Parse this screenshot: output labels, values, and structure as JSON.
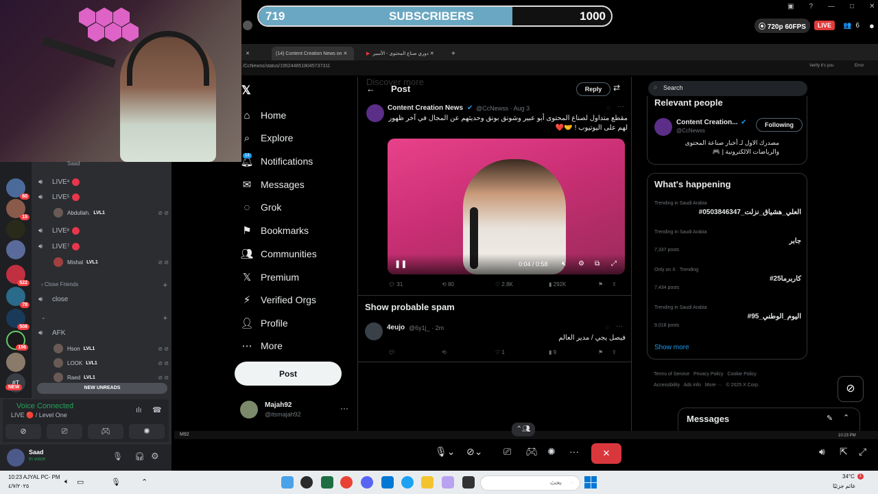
{
  "stream": {
    "subscribers_current": "719",
    "subscribers_label": "SUBSCRIBERS",
    "subscribers_goal": "1000",
    "subscribers_progress": 0.719,
    "quality": "720p 60FPS",
    "live": "LIVE",
    "viewers": "6"
  },
  "browser": {
    "tabs": [
      "(14) Content Creation News on",
      "دوري صناع المحتوى - الأسير"
    ],
    "url": "/CcNewss/status/1952448518045737311",
    "verify_label": "Verify it's you",
    "error_label": "Error"
  },
  "x_nav": {
    "items": [
      {
        "label": "Home",
        "icon": "home-icon"
      },
      {
        "label": "Explore",
        "icon": "search-icon"
      },
      {
        "label": "Notifications",
        "icon": "bell-icon",
        "badge": "14"
      },
      {
        "label": "Messages",
        "icon": "mail-icon"
      },
      {
        "label": "Grok",
        "icon": "grok-icon"
      },
      {
        "label": "Bookmarks",
        "icon": "bookmark-icon"
      },
      {
        "label": "Communities",
        "icon": "people-icon"
      },
      {
        "label": "Premium",
        "icon": "x-logo-icon"
      },
      {
        "label": "Verified Orgs",
        "icon": "lightning-icon"
      },
      {
        "label": "Profile",
        "icon": "person-icon"
      },
      {
        "label": "More",
        "icon": "more-circle-icon"
      }
    ],
    "post_label": "Post",
    "profile_name": "Majah92",
    "profile_handle": "@itsmajah92"
  },
  "post_header": {
    "title": "Post",
    "reply_label": "Reply",
    "ghost_text": "Discover more"
  },
  "tweet": {
    "author": "Content Creation News",
    "handle": "@CcNewss · Aug 3",
    "text": "مقطع متداول لصناع المحتوى أبو عبير وشونق بونق وحديثهم عن المجال في آخر ظهور لهم على اليوتيوب ! 🤝❤️",
    "video_time": "0:04 / 0:58",
    "stats": {
      "replies": "31",
      "reposts": "80",
      "likes": "2.8K",
      "views": "292K"
    }
  },
  "spam_section": {
    "heading": "Show probable spam",
    "author": "4eujo",
    "handle": "@6y1j_ · 2m",
    "text": "فيصل يجي / مدير العالم",
    "stats": {
      "likes": "1",
      "views": "9"
    }
  },
  "right_col": {
    "search_placeholder": "Search",
    "relevant_title": "Relevant people",
    "relevant_name": "Content Creation...",
    "relevant_handle": "@CcNewss",
    "following_label": "Following",
    "relevant_bio": "مصدرك الاول لـ أخبار صناعة المحتوى والرياضات الالكترونية | 🎮",
    "happening_title": "What's happening",
    "trends": [
      {
        "meta": "Trending in Saudi Arabia",
        "name": "#العلي_هشياق_نزلت_0503846347",
        "count": ""
      },
      {
        "meta": "Trending in Saudi Arabia",
        "name": "جابر",
        "count": "7,337 posts"
      },
      {
        "meta": "Only on X · Trending",
        "name": "#كاربرما25",
        "count": "7,434 posts"
      },
      {
        "meta": "Trending in Saudi Arabia",
        "name": "#اليوم_الوطني_95",
        "count": "9,018 posts"
      }
    ],
    "show_more": "Show more",
    "footer": [
      "Terms of Service",
      "Privacy Policy",
      "Cookie Policy",
      "Accessibility",
      "Ads info",
      "More ···",
      "© 2025 X Corp."
    ],
    "messages_dock": "Messages"
  },
  "discord": {
    "top_user": "Saad",
    "channels": [
      {
        "label": "LIVE",
        "sup": "4"
      },
      {
        "label": "LIVE",
        "sup": "5"
      },
      {
        "label": "LIVE",
        "sup": "6"
      },
      {
        "label": "LIVE",
        "sup": "7"
      }
    ],
    "user_abdullah": "Abdullah.",
    "user_mishal": "Mishal",
    "lvl": "LVL1",
    "close_friends": "Close Friends",
    "close": "close",
    "afk": "AFK",
    "afk_users": [
      "Hson",
      "LOOK",
      "Raed"
    ],
    "new_unreads": "NEW UNREADS",
    "voice_connected": "Voice Connected",
    "voice_channel": "LIVE 🔴 / Level One",
    "username": "Saad",
    "status": "In voice",
    "server_badges": [
      "60",
      "15",
      "522",
      "78",
      "508",
      "156"
    ],
    "new_badge": "NEW"
  },
  "taskbar": {
    "clock": "10:23 AJYAL PC- PM",
    "date": "٤/٧/٢٠٢٥",
    "search_placeholder": "بحث",
    "temp": "34°C",
    "weather": "غائم جزئيًا",
    "inner_time": "10:23 PM",
    "inner_label": "M92"
  }
}
